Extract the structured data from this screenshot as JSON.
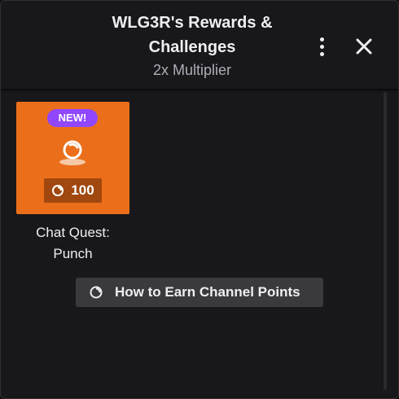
{
  "header": {
    "title_line1": "WLG3R's Rewards &",
    "title_line2": "Challenges",
    "subtitle": "2x Multiplier"
  },
  "rewards": [
    {
      "badge": "NEW!",
      "cost": "100",
      "title_line1": "Chat Quest:",
      "title_line2": "Punch",
      "icon": "punch-icon"
    }
  ],
  "earn_button": {
    "label": "How to Earn Channel Points",
    "icon": "channel-points-icon"
  },
  "colors": {
    "card_background": "#eb6f1a",
    "badge_background": "#9147ff",
    "panel_background": "#18181b"
  }
}
